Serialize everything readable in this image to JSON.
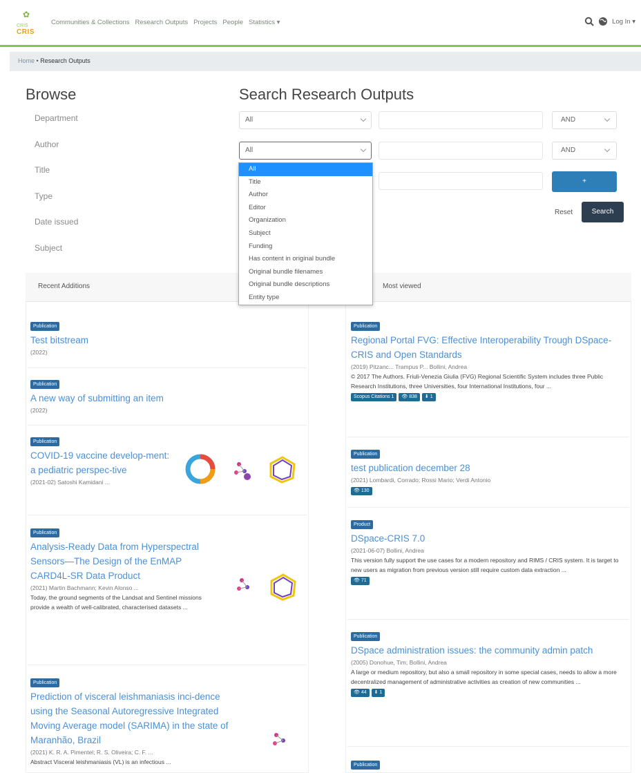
{
  "header": {
    "logo_top": "CRIS",
    "logo_bottom": "CRIS",
    "nav": [
      "Communities & Collections",
      "Research Outputs",
      "Projects",
      "People",
      "Statistics ▾"
    ],
    "login": "Log In ▾"
  },
  "breadcrumb": {
    "home": "Home",
    "sep": "•",
    "current": "Research Outputs"
  },
  "browse": {
    "title": "Browse",
    "items": [
      "Department",
      "Author",
      "Title",
      "Type",
      "Date issued",
      "Subject"
    ]
  },
  "search": {
    "title": "Search Research Outputs",
    "row1_field": "All",
    "row1_op": "AND",
    "row2_field": "All",
    "row2_op": "AND",
    "add_label": "+",
    "reset_label": "Reset",
    "search_label": "Search",
    "dropdown_options": [
      "All",
      "Title",
      "Author",
      "Editor",
      "Organization",
      "Subject",
      "Funding",
      "Has content in original bundle",
      "Original bundle filenames",
      "Original bundle descriptions",
      "Entity type"
    ]
  },
  "recent": {
    "heading": "Recent Additions",
    "items": [
      {
        "badge": "Publication",
        "title": "Test bitstream",
        "meta": "(2022)"
      },
      {
        "badge": "Publication",
        "title": "A new way of submitting an item",
        "meta": "(2022)"
      },
      {
        "badge": "Publication",
        "title": "COVID-19 vaccine develop-ment: a pediatric perspec-tive",
        "meta": "(2021-02) Satoshi Kamidani ..."
      },
      {
        "badge": "Publication",
        "title": "Analysis-Ready Data from Hyperspectral Sensors—The Design of the EnMAP CARD4L-SR Data Product",
        "meta": "(2021) Martin Bachmann; Kevin Alonso ...",
        "abstract": "Today, the ground segments of the Landsat and Sentinel missions provide a wealth of well-calibrated, characterised datasets ..."
      },
      {
        "badge": "Publication",
        "title": "Prediction of visceral leishmaniasis inci-dence using the Seasonal Autoregressive Integrated Moving Average model (SARIMA) in the state of Maranhão, Brazil",
        "meta": "(2021) K. R. A. Pimentel; R. S. Oliveira; C. F. ...",
        "abstract": "Abstract Visceral leishmaniasis (VL) is an infectious ..."
      }
    ]
  },
  "viewed": {
    "heading": "Most viewed",
    "items": [
      {
        "badge": "Publication",
        "title": "Regional Portal FVG: Effective Interoperability Trough DSpace-CRIS and Open Standards",
        "meta": "(2019) Pitzanc... Trampus P... Bollini, Andrea",
        "abstract": "© 2017 The Authors. Friuli-Venezia Giulia (FVG) Regional Scientific System includes three Public Research Institutions, three Universities, four International Institutions, four ...",
        "stats": [
          "Scopus Citations 1",
          "👁 838",
          "⬇ 1"
        ]
      },
      {
        "badge": "Publication",
        "title": "test publication december 28",
        "meta": "(2021) Lombardi, Corrado; Rossi Mario; Verdi Antonio",
        "stats": [
          "👁 130"
        ]
      },
      {
        "badge": "Product",
        "title": "DSpace-CRIS 7.0",
        "meta": "(2021-06-07) Bollini, Andrea",
        "abstract": "This version fully support the use cases for a modern repository and RIMS / CRIS system. It is target to new users as migration from previous version still require custom data extraction ...",
        "stats": [
          "👁 71"
        ]
      },
      {
        "badge": "Publication",
        "title": "DSpace administration issues: the community admin patch",
        "meta": "(2005) Donohue, Tim; Bollini, Andrea",
        "abstract": "A large or medium repository, but also a small repository in some special cases, needs to allow a more decentralized management of administrative activities as creation of new communities ...",
        "stats": [
          "👁 44",
          "⬇ 1"
        ]
      },
      {
        "badge": "Publication",
        "title": "",
        "meta": ""
      }
    ]
  },
  "colors": {
    "accent": "#8bc34a",
    "link": "#4a90d9",
    "primary_button": "#2e7fb8",
    "dark_button": "#2c3e50"
  }
}
